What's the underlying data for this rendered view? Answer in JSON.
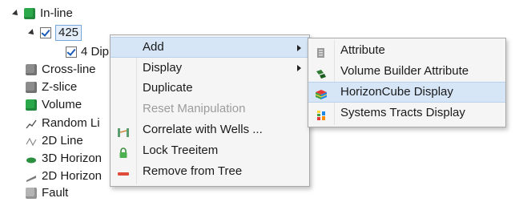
{
  "tree": {
    "items": [
      {
        "label": "In-line"
      },
      {
        "label": "425"
      },
      {
        "label": "4 Dip"
      },
      {
        "label": "Cross-line"
      },
      {
        "label": "Z-slice"
      },
      {
        "label": "Volume"
      },
      {
        "label": "Random Li"
      },
      {
        "label": "2D Line"
      },
      {
        "label": "3D Horizon"
      },
      {
        "label": "2D Horizon"
      },
      {
        "label": "Fault"
      }
    ]
  },
  "context_menu": {
    "items": [
      {
        "label": "Add",
        "has_submenu": true,
        "icon": ""
      },
      {
        "label": "Display",
        "has_submenu": true,
        "icon": ""
      },
      {
        "label": "Duplicate",
        "icon": ""
      },
      {
        "label": "Reset Manipulation",
        "disabled": true,
        "icon": ""
      },
      {
        "label": "Correlate with Wells ...",
        "icon": "correlate-wells-icon"
      },
      {
        "label": "Lock Treeitem",
        "icon": "lock-icon"
      },
      {
        "label": "Remove from Tree",
        "icon": "remove-icon"
      }
    ]
  },
  "submenu": {
    "items": [
      {
        "label": "Attribute",
        "icon": "attribute-icon"
      },
      {
        "label": "Volume Builder Attribute",
        "icon": "volume-builder-icon"
      },
      {
        "label": "HorizonCube Display",
        "icon": "horizoncube-icon",
        "highlighted": true
      },
      {
        "label": "Systems Tracts Display",
        "icon": "systems-tracts-icon"
      }
    ]
  },
  "colors": {
    "accent": "#d6e6f7",
    "green": "#2aa84a",
    "disabled_text": "#9c9c9c"
  }
}
